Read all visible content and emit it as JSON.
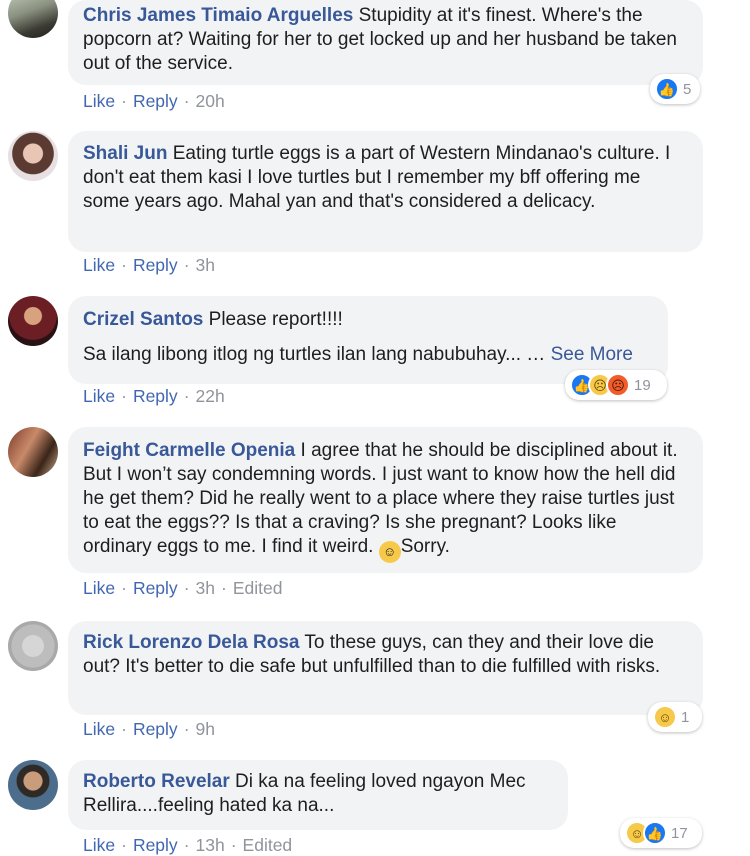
{
  "comments": [
    {
      "author": "Chris James Timaio Arguelles",
      "text": " Stupidity at it's finest. Where's the popcorn at? Waiting for her to get locked up and her husband be taken out of the service.",
      "like": "Like",
      "reply": "Reply",
      "time": "20h",
      "reaction_count": "5"
    },
    {
      "author": "Shali Jun",
      "text": " Eating turtle eggs is a part of Western Mindanao's culture. I don't eat them kasi I love turtles but I remember my bff offering me some years ago. Mahal yan and that's considered a delicacy.",
      "like": "Like",
      "reply": "Reply",
      "time": "3h"
    },
    {
      "author": "Crizel Santos",
      "text": " Please report!!!!",
      "text2": "Sa ilang libong itlog ng turtles ilan lang nabubuhay... …",
      "see_more": "See More",
      "like": "Like",
      "reply": "Reply",
      "time": "22h",
      "reaction_count": "19"
    },
    {
      "author": "Feight Carmelle Openia",
      "text": " I agree that he should be disciplined about it. But I won’t say condemning words. I just want to know how the hell did he get them? Did he really went to a place where they raise turtles just to eat the eggs?? Is that a craving? Is she pregnant? Looks like ordinary eggs to me. I find it weird. ",
      "text_end": "Sorry.",
      "like": "Like",
      "reply": "Reply",
      "time": "3h",
      "edited": "Edited"
    },
    {
      "author": "Rick Lorenzo Dela Rosa",
      "text": " To these guys, can they and their love die out? It's better to die safe but unfulfilled than to die fulfilled with risks.",
      "like": "Like",
      "reply": "Reply",
      "time": "9h",
      "reaction_count": "1"
    },
    {
      "author": "Roberto Revelar",
      "text": " Di ka na feeling loved ngayon Mec Rellira....feeling hated ka na...",
      "like": "Like",
      "reply": "Reply",
      "time": "13h",
      "edited": "Edited",
      "reaction_count": "17"
    }
  ],
  "sep": "·",
  "icons": {
    "like": "thumbs-up-icon",
    "sad": "sad-face-icon",
    "angry": "angry-face-icon",
    "haha": "laughing-face-icon",
    "scream": "screaming-face-icon"
  },
  "colors": {
    "author": "#385898",
    "action": "#4267b2",
    "meta": "#90949c",
    "bubble": "#f2f3f5"
  }
}
